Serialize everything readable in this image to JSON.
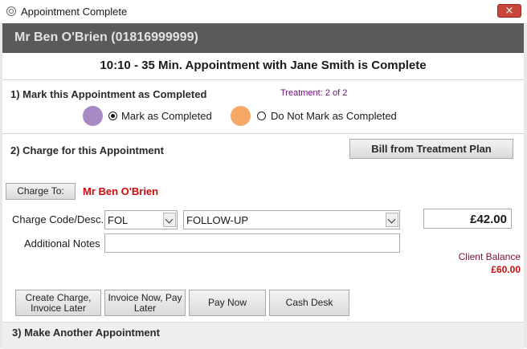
{
  "window": {
    "title": "Appointment Complete",
    "close_icon": "×"
  },
  "client": {
    "header": "Mr Ben O'Brien (01816999999)"
  },
  "appointment": {
    "summary": "10:10 - 35 Min. Appointment with Jane Smith is Complete"
  },
  "section1": {
    "title": "1) Mark this Appointment as Completed",
    "treatment": "Treatment: 2 of 2",
    "option_completed": {
      "label": "Mark as Completed",
      "selected": true,
      "color": "#a789c3"
    },
    "option_not_completed": {
      "label": "Do Not Mark as Completed",
      "selected": false,
      "color": "#f6a867"
    }
  },
  "section2": {
    "title": "2) Charge for this Appointment",
    "bill_button": "Bill from Treatment Plan",
    "charge_to_button": "Charge To:",
    "charge_to_name": "Mr Ben O'Brien",
    "charge_code_label": "Charge Code/Desc.",
    "charge_code_value": "FOL",
    "charge_desc_value": "FOLLOW-UP",
    "amount": "£42.00",
    "notes_label": "Additional Notes",
    "notes_value": "",
    "client_balance_label": "Client Balance",
    "client_balance_value": "£60.00",
    "actions": {
      "create_charge": "Create Charge, Invoice Later",
      "invoice_now": "Invoice Now, Pay Later",
      "pay_now": "Pay Now",
      "cash_desk": "Cash Desk"
    }
  },
  "section3": {
    "title": "3) Make Another Appointment"
  }
}
